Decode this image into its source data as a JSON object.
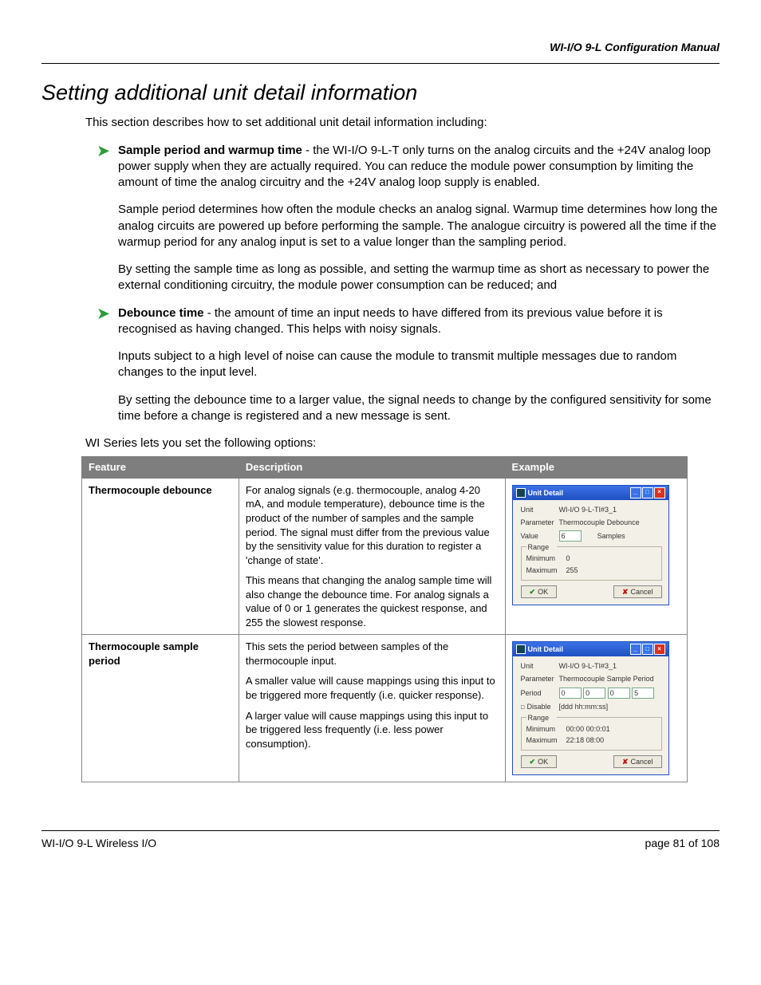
{
  "header": {
    "manual_title": "WI-I/O 9-L Configuration Manual"
  },
  "title": "Setting additional unit detail information",
  "intro": "This section describes how to set additional unit detail information including:",
  "bullet1": {
    "lead": "Sample period and warmup time",
    "after": " - the WI-I/O 9-L-T only turns on the analog circuits and the +24V analog loop power supply when they are actually required. You can reduce the module power consumption by limiting the amount of time the analog circuitry and the +24V analog loop supply is enabled.",
    "p2": "Sample period determines how often the module checks an analog signal. Warmup time determines how long the analog circuits are powered up before performing the sample. The analogue circuitry is powered all the time if the warmup period for any analog input is set to a value longer than the sampling period.",
    "p3": "By setting the sample time as long as possible, and setting the warmup time as short as necessary to power the external conditioning circuitry, the module power consumption can be reduced; and"
  },
  "bullet2": {
    "lead": "Debounce time",
    "after": " - the amount of time an input needs to have differed from its previous value before it is recognised as having changed. This helps with noisy signals.",
    "p2": "Inputs subject to a high level of noise can cause the module to transmit multiple messages due to random changes to the input level.",
    "p3": "By setting the debounce time to a larger value, the signal needs to change by the configured sensitivity for some time before a change is registered and a new message is sent."
  },
  "options_line": "WI Series lets you set the following options:",
  "table": {
    "headers": {
      "feature": "Feature",
      "description": "Description",
      "example": "Example"
    },
    "rows": [
      {
        "feature": "Thermocouple debounce",
        "desc_p1": "For analog signals (e.g. thermocouple, analog 4-20 mA, and module temperature), debounce time is the product of the number of samples and the sample period. The signal must differ from the previous value by the sensitivity value for this duration to register a 'change of state'.",
        "desc_p2": "This means that changing the analog sample time will also change the debounce time. For analog signals a value of 0 or 1 generates the quickest response, and 255 the slowest response.",
        "dialog": {
          "title": "Unit Detail",
          "unit_label": "Unit",
          "unit_value": "WI-I/O 9-L-TI#3_1",
          "param_label": "Parameter",
          "param_value": "Thermocouple Debounce",
          "value_label": "Value",
          "value_input": "6",
          "value_suffix": "Samples",
          "range_label": "Range",
          "min_label": "Minimum",
          "min_value": "0",
          "max_label": "Maximum",
          "max_value": "255",
          "ok": "OK",
          "cancel": "Cancel"
        }
      },
      {
        "feature": "Thermocouple sample period",
        "desc_p1": "This sets the period between samples of the thermocouple input.",
        "desc_p2": "A smaller value will cause mappings using this input to be triggered more frequently (i.e. quicker response).",
        "desc_p3": "A larger value will cause mappings using this input to be triggered less frequently (i.e. less power consumption).",
        "dialog": {
          "title": "Unit Detail",
          "unit_label": "Unit",
          "unit_value": "WI-I/O 9-L-TI#3_1",
          "param_label": "Parameter",
          "param_value": "Thermocouple Sample Period",
          "period_label": "Period",
          "period_d": "0",
          "period_h": "0",
          "period_m": "0",
          "period_s": "5",
          "disable_label": "Disable",
          "format_hint": "[ddd hh:mm:ss]",
          "range_label": "Range",
          "min_label": "Minimum",
          "min_value": "00:00 00:0:01",
          "max_label": "Maximum",
          "max_value": "22:18 08:00",
          "ok": "OK",
          "cancel": "Cancel"
        }
      }
    ]
  },
  "footer": {
    "left": "WI-I/O 9-L Wireless I/O",
    "right_prefix": "page ",
    "page": "81",
    "right_suffix": " of 108"
  }
}
